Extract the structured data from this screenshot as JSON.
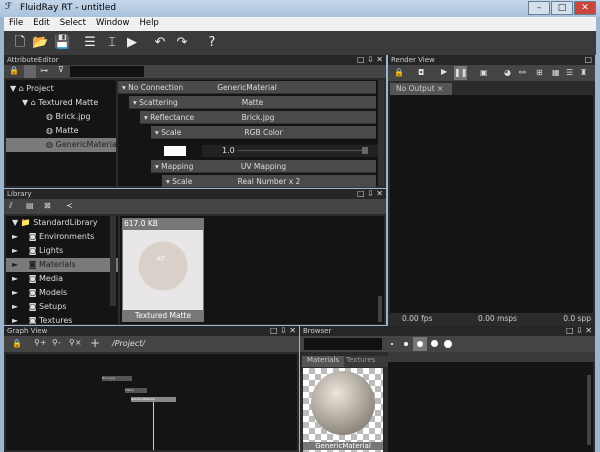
{
  "window": {
    "title": "FluidRay RT - untitled",
    "minimize": "–",
    "maximize": "□",
    "close": "✕"
  },
  "menu": [
    "File",
    "Edit",
    "Select",
    "Window",
    "Help"
  ],
  "toolbar": {
    "icons": [
      "new-file",
      "open-folder",
      "save",
      "settings-panel",
      "hierarchy",
      "render-play",
      "undo",
      "redo",
      "help"
    ],
    "glyphs": [
      "🗋",
      "📂",
      "💾",
      "☰",
      "⌶",
      "▶",
      "↶",
      "↷",
      "?"
    ]
  },
  "attribute_editor": {
    "title": "AttributeEditor",
    "filter_value": "",
    "tree": [
      {
        "label": "Project",
        "indent": 0,
        "expanded": true
      },
      {
        "label": "Textured Matte",
        "indent": 1,
        "expanded": true
      },
      {
        "label": "Brick.jpg",
        "indent": 2
      },
      {
        "label": "Matte",
        "indent": 2
      },
      {
        "label": "GenericMaterial",
        "indent": 2,
        "selected": true
      }
    ],
    "rows": [
      {
        "name": "No Connection",
        "value": "GenericMaterial",
        "level": 0
      },
      {
        "name": "Scattering",
        "value": "Matte",
        "level": 1
      },
      {
        "name": "Reflectance",
        "value": "Brick.jpg",
        "level": 2
      },
      {
        "name": "Scale",
        "value": "RGB Color",
        "level": 3
      },
      {
        "name": "Mapping",
        "value": "UV Mapping",
        "level": 3
      },
      {
        "name": "Scale",
        "value": "Real Number x 2",
        "level": 4
      }
    ],
    "color_value": "1.0",
    "swatch": "#ffffff"
  },
  "library": {
    "title": "Library",
    "tree": [
      {
        "label": "StandardLibrary",
        "expanded": true
      },
      {
        "label": "Environments"
      },
      {
        "label": "Lights"
      },
      {
        "label": "Materials",
        "selected": true
      },
      {
        "label": "Media"
      },
      {
        "label": "Models"
      },
      {
        "label": "Setups"
      },
      {
        "label": "Textures"
      }
    ],
    "item": {
      "size": "617.0 KB",
      "name": "Textured Matte",
      "logo": "FluidRay RT"
    }
  },
  "graph_view": {
    "title": "Graph View",
    "path": "/Project/",
    "nodes": [
      "Brick.jpg",
      "Matte",
      "GenericMaterial"
    ]
  },
  "browser": {
    "title": "Browser",
    "search": "",
    "tabs": [
      "Materials",
      "Textures"
    ],
    "active_tab": "Materials",
    "item": "GenericMaterial"
  },
  "render_view": {
    "title": "Render View",
    "output_tab": "No Output",
    "fps": "0.00 fps",
    "msps": "0.00 msps",
    "spp": "0.0 spp"
  },
  "panel_controls": {
    "float": "□",
    "pin": "⇩",
    "close": "✕"
  }
}
